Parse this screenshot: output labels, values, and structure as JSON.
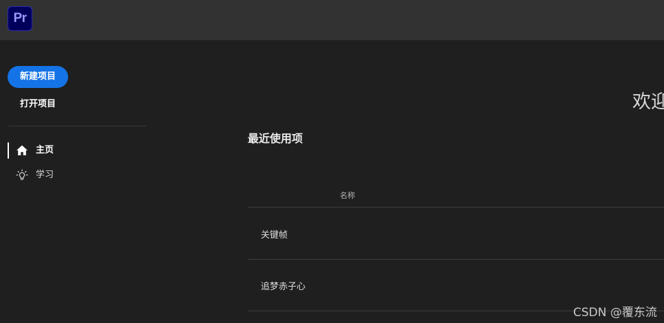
{
  "app": {
    "logo_text": "Pr",
    "brand_color": "#00005b",
    "accent_color": "#1473e6"
  },
  "sidebar": {
    "new_project_label": "新建项目",
    "open_project_label": "打开项目",
    "nav": [
      {
        "label": "主页",
        "icon": "home-icon",
        "active": true
      },
      {
        "label": "学习",
        "icon": "lightbulb-icon",
        "active": false
      }
    ]
  },
  "main": {
    "welcome_text": "欢迎",
    "recent_title": "最近使用项",
    "table": {
      "columns": [
        "名称"
      ],
      "rows": [
        {
          "name": "关键帧"
        },
        {
          "name": "追梦赤子心"
        }
      ]
    }
  },
  "watermark": "CSDN @覆东流"
}
